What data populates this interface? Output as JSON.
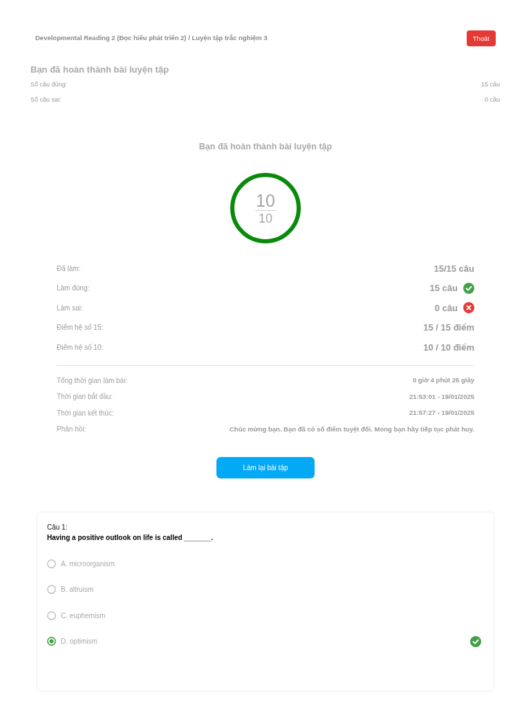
{
  "header": {
    "breadcrumb": "Developmental Reading 2 (Đọc hiểu phát triển 2) / Luyện tập trắc nghiệm 3",
    "exit_button": "Thoát"
  },
  "summary": {
    "title": "Bạn đã hoàn thành bài luyện tập",
    "rows": [
      {
        "label": "Số câu đúng:",
        "value": "15 câu"
      },
      {
        "label": "Số câu sai:",
        "value": "0 câu"
      }
    ]
  },
  "result": {
    "title": "Bạn đã hoàn thành bài luyện tập",
    "score": {
      "value": "10",
      "total": "10",
      "level": 1
    },
    "stats": [
      {
        "label": "Đã làm:",
        "value": "15/15 câu",
        "kind": "plain"
      },
      {
        "label": "Làm đúng:",
        "value": "15 câu",
        "kind": "correct"
      },
      {
        "label": "Làm sai:",
        "value": "0 câu",
        "kind": "wrong"
      },
      {
        "label": "Điểm hệ số 15:",
        "value": "15 / 15 điểm",
        "kind": "plain"
      },
      {
        "label": "Điểm hệ số 10:",
        "value": "10 / 10 điểm",
        "kind": "plain"
      }
    ],
    "details": [
      {
        "label": "Tổng thời gian làm bài:",
        "value": "0 giờ 4 phút 26 giây"
      },
      {
        "label": "Thời gian bắt đầu:",
        "value": "21:53:01 - 19/01/2025"
      },
      {
        "label": "Thời gian kết thúc:",
        "value": "21:57:27 - 19/01/2025"
      },
      {
        "label": "Phản hồi:",
        "value": "Chúc mừng bạn. Bạn đã có số điểm tuyệt đối. Mong bạn hãy tiếp tục phát huy."
      }
    ],
    "retry_button": "Làm lại bài tập"
  },
  "questions": [
    {
      "number": "Câu 1:",
      "text": "Having a positive outlook on life is called _______.",
      "options": [
        {
          "label": "A. microorganism",
          "selected": false,
          "correct": false
        },
        {
          "label": "B. altruism",
          "selected": false,
          "correct": false
        },
        {
          "label": "C. euphemism",
          "selected": false,
          "correct": false
        },
        {
          "label": "D. optimism",
          "selected": true,
          "correct": true
        }
      ]
    }
  ]
}
